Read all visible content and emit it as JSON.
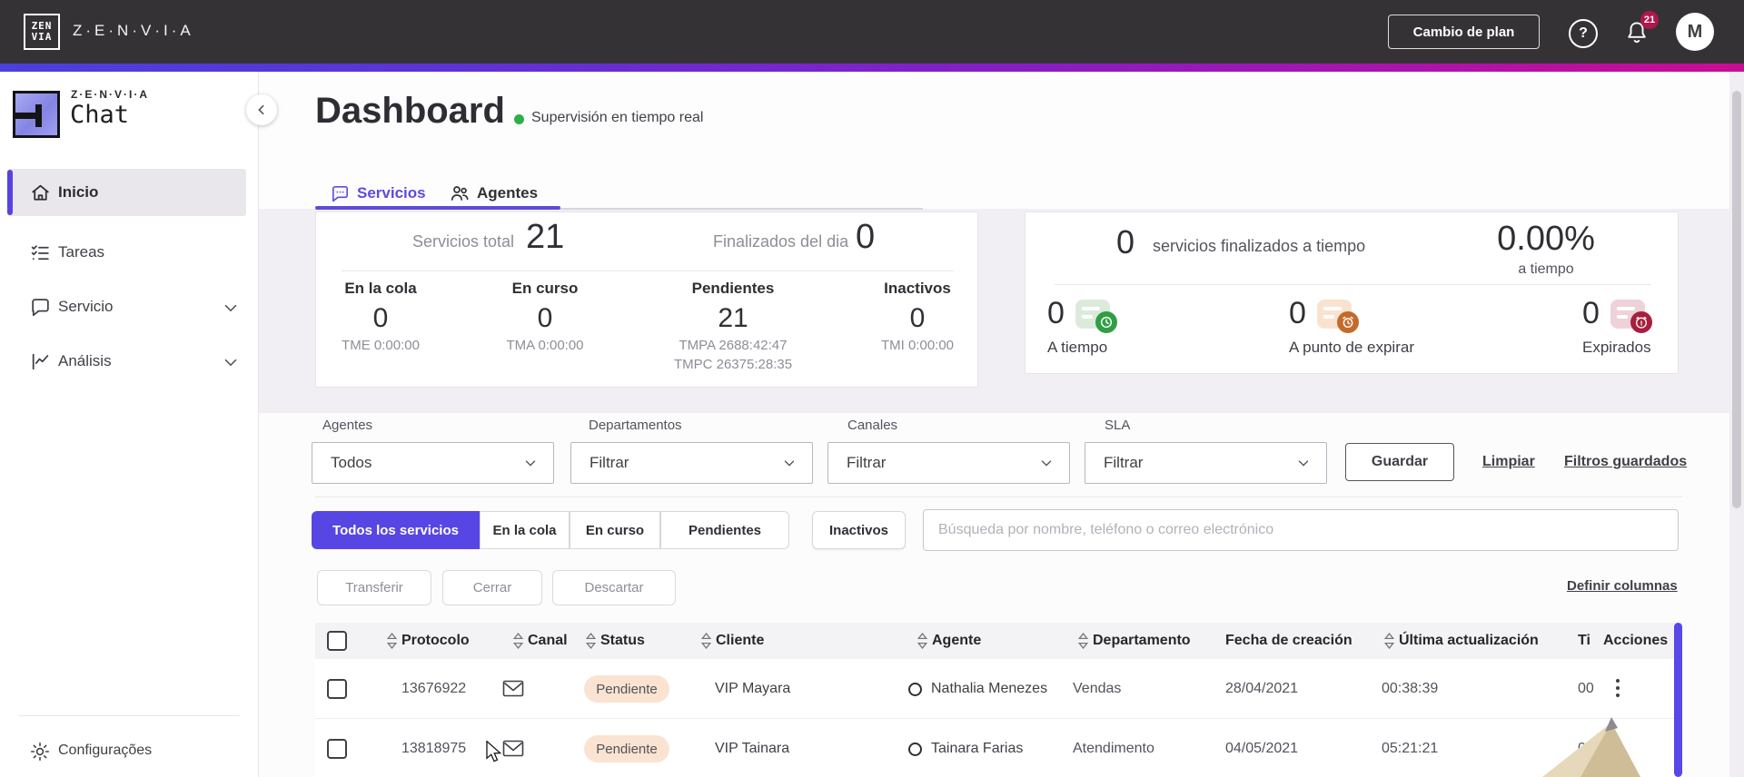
{
  "topbar": {
    "brand": "Z·E·N·V·I·A",
    "logo_top": "ZEN",
    "logo_bottom": "VIA",
    "plan_button": "Cambio de plan",
    "help_glyph": "?",
    "notifications_count": "21",
    "avatar_initial": "M"
  },
  "sidebar": {
    "logo_brand": "Z·E·N·V·I·A",
    "logo_product": "Chat",
    "items": [
      {
        "label": "Inicio"
      },
      {
        "label": "Tareas"
      },
      {
        "label": "Servicio"
      },
      {
        "label": "Análisis"
      }
    ],
    "footer_item": "Configurações"
  },
  "header": {
    "title": "Dashboard",
    "status": "Supervisión en tiempo real"
  },
  "tabs": {
    "servicios": "Servicios",
    "agentes": "Agentes"
  },
  "summary": {
    "total_label": "Servicios total",
    "total_value": "21",
    "finished_label": "Finalizados del dia",
    "finished_value": "0",
    "columns": [
      {
        "label": "En la cola",
        "value": "0",
        "times": [
          "TME 0:00:00"
        ]
      },
      {
        "label": "En curso",
        "value": "0",
        "times": [
          "TMA 0:00:00"
        ]
      },
      {
        "label": "Pendientes",
        "value": "21",
        "times": [
          "TMPA 2688:42:47",
          "TMPC 26375:28:35"
        ]
      },
      {
        "label": "Inactivos",
        "value": "0",
        "times": [
          "TMI 0:00:00"
        ]
      }
    ]
  },
  "sla": {
    "finished_value": "0",
    "finished_label": "servicios finalizados a tiempo",
    "percent": "0.00%",
    "percent_label": "a tiempo",
    "items": [
      {
        "value": "0",
        "label": "A tiempo",
        "bubble_color": "#dceadb",
        "badge_color": "#2f9e44"
      },
      {
        "value": "0",
        "label": "A punto de expirar",
        "bubble_color": "#f9e3d0",
        "badge_color": "#c56a28"
      },
      {
        "value": "0",
        "label": "Expirados",
        "bubble_color": "#eed2da",
        "badge_color": "#a81f3d"
      }
    ]
  },
  "filters": {
    "fields": [
      {
        "label": "Agentes",
        "value": "Todos"
      },
      {
        "label": "Departamentos",
        "value": "Filtrar"
      },
      {
        "label": "Canales",
        "value": "Filtrar"
      },
      {
        "label": "SLA",
        "value": "Filtrar"
      }
    ],
    "save_button": "Guardar",
    "clear_link": "Limpiar",
    "saved_link": "Filtros guardados"
  },
  "service_tabs": {
    "all": "Todos los servicios",
    "queue": "En la cola",
    "in_progress": "En curso",
    "pending": "Pendientes",
    "inactive": "Inactivos"
  },
  "search": {
    "placeholder": "Búsqueda por nombre, teléfono o correo electrónico"
  },
  "actions": {
    "transfer": "Transferir",
    "close": "Cerrar",
    "discard": "Descartar",
    "columns_link": "Definir columnas"
  },
  "table": {
    "headers": {
      "protocolo": "Protocolo",
      "canal": "Canal",
      "status": "Status",
      "cliente": "Cliente",
      "agente": "Agente",
      "departamento": "Departamento",
      "fecha": "Fecha de creación",
      "ultima": "Última actualización",
      "tiempo": "Ti",
      "acciones": "Acciones"
    },
    "rows": [
      {
        "protocolo": "13676922",
        "canal": "email",
        "status": "Pendiente",
        "cliente": "VIP Mayara",
        "agente": "Nathalia Menezes",
        "departamento": "Vendas",
        "fecha": "28/04/2021",
        "ultima": "00:38:39",
        "tiempo_clipped": "00"
      },
      {
        "protocolo": "13818975",
        "canal": "email",
        "status": "Pendiente",
        "cliente": "VIP Tainara",
        "agente": "Tainara Farias",
        "departamento": "Atendimento",
        "fecha": "04/05/2021",
        "ultima": "05:21:21",
        "tiempo_clipped": "05"
      }
    ]
  },
  "colors": {
    "accent": "#5746e3",
    "topbar": "#343235",
    "gradient": [
      "#4a40dd",
      "#8a1cc4",
      "#cb0b95"
    ],
    "badge_red": "#b2164e",
    "pending_badge_bg": "#fbe3d1",
    "live_green": "#2fae4a"
  }
}
